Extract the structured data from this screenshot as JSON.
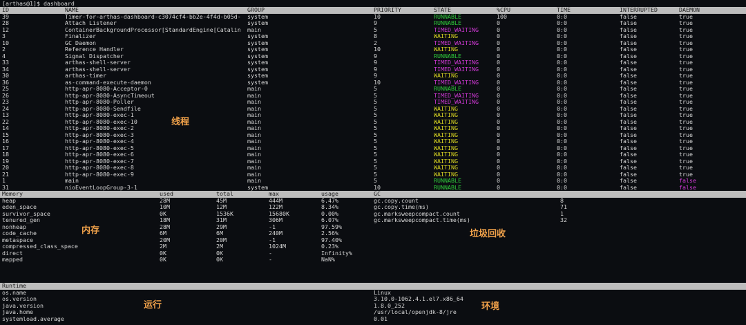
{
  "prompt": "[arthas@1]$ dashboard",
  "threads": {
    "headers": [
      "ID",
      "NAME",
      "GROUP",
      "PRIORITY",
      "STATE",
      "%CPU",
      "TIME",
      "INTERRUPTED",
      "DAEMON"
    ],
    "rows": [
      [
        "39",
        "Timer-for-arthas-dashboard-c3074cf4-bb2e-4f4d-b05d-",
        "system",
        "10",
        "RUNNABLE",
        "100",
        "0:0",
        "false",
        "true"
      ],
      [
        "28",
        "Attach Listener",
        "system",
        "9",
        "RUNNABLE",
        "0",
        "0:0",
        "false",
        "true"
      ],
      [
        "12",
        "ContainerBackgroundProcessor[StandardEngine[Catalin",
        "main",
        "5",
        "TIMED_WAITING",
        "0",
        "0:0",
        "false",
        "true"
      ],
      [
        "3",
        "Finalizer",
        "system",
        "8",
        "WAITING",
        "0",
        "0:0",
        "false",
        "true"
      ],
      [
        "10",
        "GC Daemon",
        "system",
        "2",
        "TIMED_WAITING",
        "0",
        "0:0",
        "false",
        "true"
      ],
      [
        "2",
        "Reference Handler",
        "system",
        "10",
        "WAITING",
        "0",
        "0:0",
        "false",
        "true"
      ],
      [
        "4",
        "Signal Dispatcher",
        "system",
        "9",
        "RUNNABLE",
        "0",
        "0:0",
        "false",
        "true"
      ],
      [
        "33",
        "arthas-shell-server",
        "system",
        "9",
        "TIMED_WAITING",
        "0",
        "0:0",
        "false",
        "true"
      ],
      [
        "34",
        "arthas-shell-server",
        "system",
        "9",
        "TIMED_WAITING",
        "0",
        "0:0",
        "false",
        "true"
      ],
      [
        "30",
        "arthas-timer",
        "system",
        "9",
        "WAITING",
        "0",
        "0:0",
        "false",
        "true"
      ],
      [
        "36",
        "as-command-execute-daemon",
        "system",
        "10",
        "TIMED_WAITING",
        "0",
        "0:0",
        "false",
        "true"
      ],
      [
        "25",
        "http-apr-8080-Acceptor-0",
        "main",
        "5",
        "RUNNABLE",
        "0",
        "0:0",
        "false",
        "true"
      ],
      [
        "26",
        "http-apr-8080-AsyncTimeout",
        "main",
        "5",
        "TIMED_WAITING",
        "0",
        "0:0",
        "false",
        "true"
      ],
      [
        "23",
        "http-apr-8080-Poller",
        "main",
        "5",
        "TIMED_WAITING",
        "0",
        "0:0",
        "false",
        "true"
      ],
      [
        "24",
        "http-apr-8080-Sendfile",
        "main",
        "5",
        "WAITING",
        "0",
        "0:0",
        "false",
        "true"
      ],
      [
        "13",
        "http-apr-8080-exec-1",
        "main",
        "5",
        "WAITING",
        "0",
        "0:0",
        "false",
        "true"
      ],
      [
        "22",
        "http-apr-8080-exec-10",
        "main",
        "5",
        "WAITING",
        "0",
        "0:0",
        "false",
        "true"
      ],
      [
        "14",
        "http-apr-8080-exec-2",
        "main",
        "5",
        "WAITING",
        "0",
        "0:0",
        "false",
        "true"
      ],
      [
        "15",
        "http-apr-8080-exec-3",
        "main",
        "5",
        "WAITING",
        "0",
        "0:0",
        "false",
        "true"
      ],
      [
        "16",
        "http-apr-8080-exec-4",
        "main",
        "5",
        "WAITING",
        "0",
        "0:0",
        "false",
        "true"
      ],
      [
        "17",
        "http-apr-8080-exec-5",
        "main",
        "5",
        "WAITING",
        "0",
        "0:0",
        "false",
        "true"
      ],
      [
        "18",
        "http-apr-8080-exec-6",
        "main",
        "5",
        "WAITING",
        "0",
        "0:0",
        "false",
        "true"
      ],
      [
        "19",
        "http-apr-8080-exec-7",
        "main",
        "5",
        "WAITING",
        "0",
        "0:0",
        "false",
        "true"
      ],
      [
        "20",
        "http-apr-8080-exec-8",
        "main",
        "5",
        "WAITING",
        "0",
        "0:0",
        "false",
        "true"
      ],
      [
        "21",
        "http-apr-8080-exec-9",
        "main",
        "5",
        "WAITING",
        "0",
        "0:0",
        "false",
        "true"
      ],
      [
        "1",
        "main",
        "main",
        "5",
        "RUNNABLE",
        "0",
        "0:0",
        "false",
        "false"
      ],
      [
        "31",
        "nioEventLoopGroup-3-1",
        "system",
        "10",
        "RUNNABLE",
        "0",
        "0:0",
        "false",
        "false"
      ]
    ]
  },
  "memory": {
    "headers": [
      "Memory",
      "used",
      "total",
      "max",
      "usage"
    ],
    "rows": [
      [
        "heap",
        "28M",
        "45M",
        "444M",
        "6.47%"
      ],
      [
        "eden_space",
        "10M",
        "12M",
        "122M",
        "8.34%"
      ],
      [
        "survivor_space",
        "0K",
        "1536K",
        "15680K",
        "0.00%"
      ],
      [
        "tenured_gen",
        "18M",
        "31M",
        "306M",
        "6.07%"
      ],
      [
        "nonheap",
        "28M",
        "29M",
        "-1",
        "97.59%"
      ],
      [
        "code_cache",
        "6M",
        "6M",
        "240M",
        "2.56%"
      ],
      [
        "metaspace",
        "20M",
        "20M",
        "-1",
        "97.40%"
      ],
      [
        "compressed_class_space",
        "2M",
        "2M",
        "1024M",
        "0.23%"
      ],
      [
        "direct",
        "0K",
        "0K",
        "-",
        "Infinity%"
      ],
      [
        "mapped",
        "0K",
        "0K",
        "-",
        "NaN%"
      ]
    ]
  },
  "gc": {
    "header": "GC",
    "rows": [
      [
        "gc.copy.count",
        "8"
      ],
      [
        "gc.copy.time(ms)",
        "71"
      ],
      [
        "gc.marksweepcompact.count",
        "1"
      ],
      [
        "gc.marksweepcompact.time(ms)",
        "32"
      ]
    ]
  },
  "runtime": {
    "header": "Runtime",
    "rows": [
      [
        "os.name",
        "Linux"
      ],
      [
        "os.version",
        "3.10.0-1062.4.1.el7.x86_64"
      ],
      [
        "java.version",
        "1.8.0_252"
      ],
      [
        "java.home",
        "/usr/local/openjdk-8/jre"
      ],
      [
        "systemload.average",
        "0.01"
      ]
    ]
  },
  "annotations": {
    "threads": "线程",
    "memory": "内存",
    "gc": "垃圾回收",
    "runtime": "运行",
    "environment": "环境"
  },
  "colors": {
    "runnable": "#2ec93a",
    "timed_waiting": "#d23ad8",
    "waiting": "#d7d321",
    "header_bg": "#bdbdbd",
    "annotation": "#f0a14a"
  }
}
